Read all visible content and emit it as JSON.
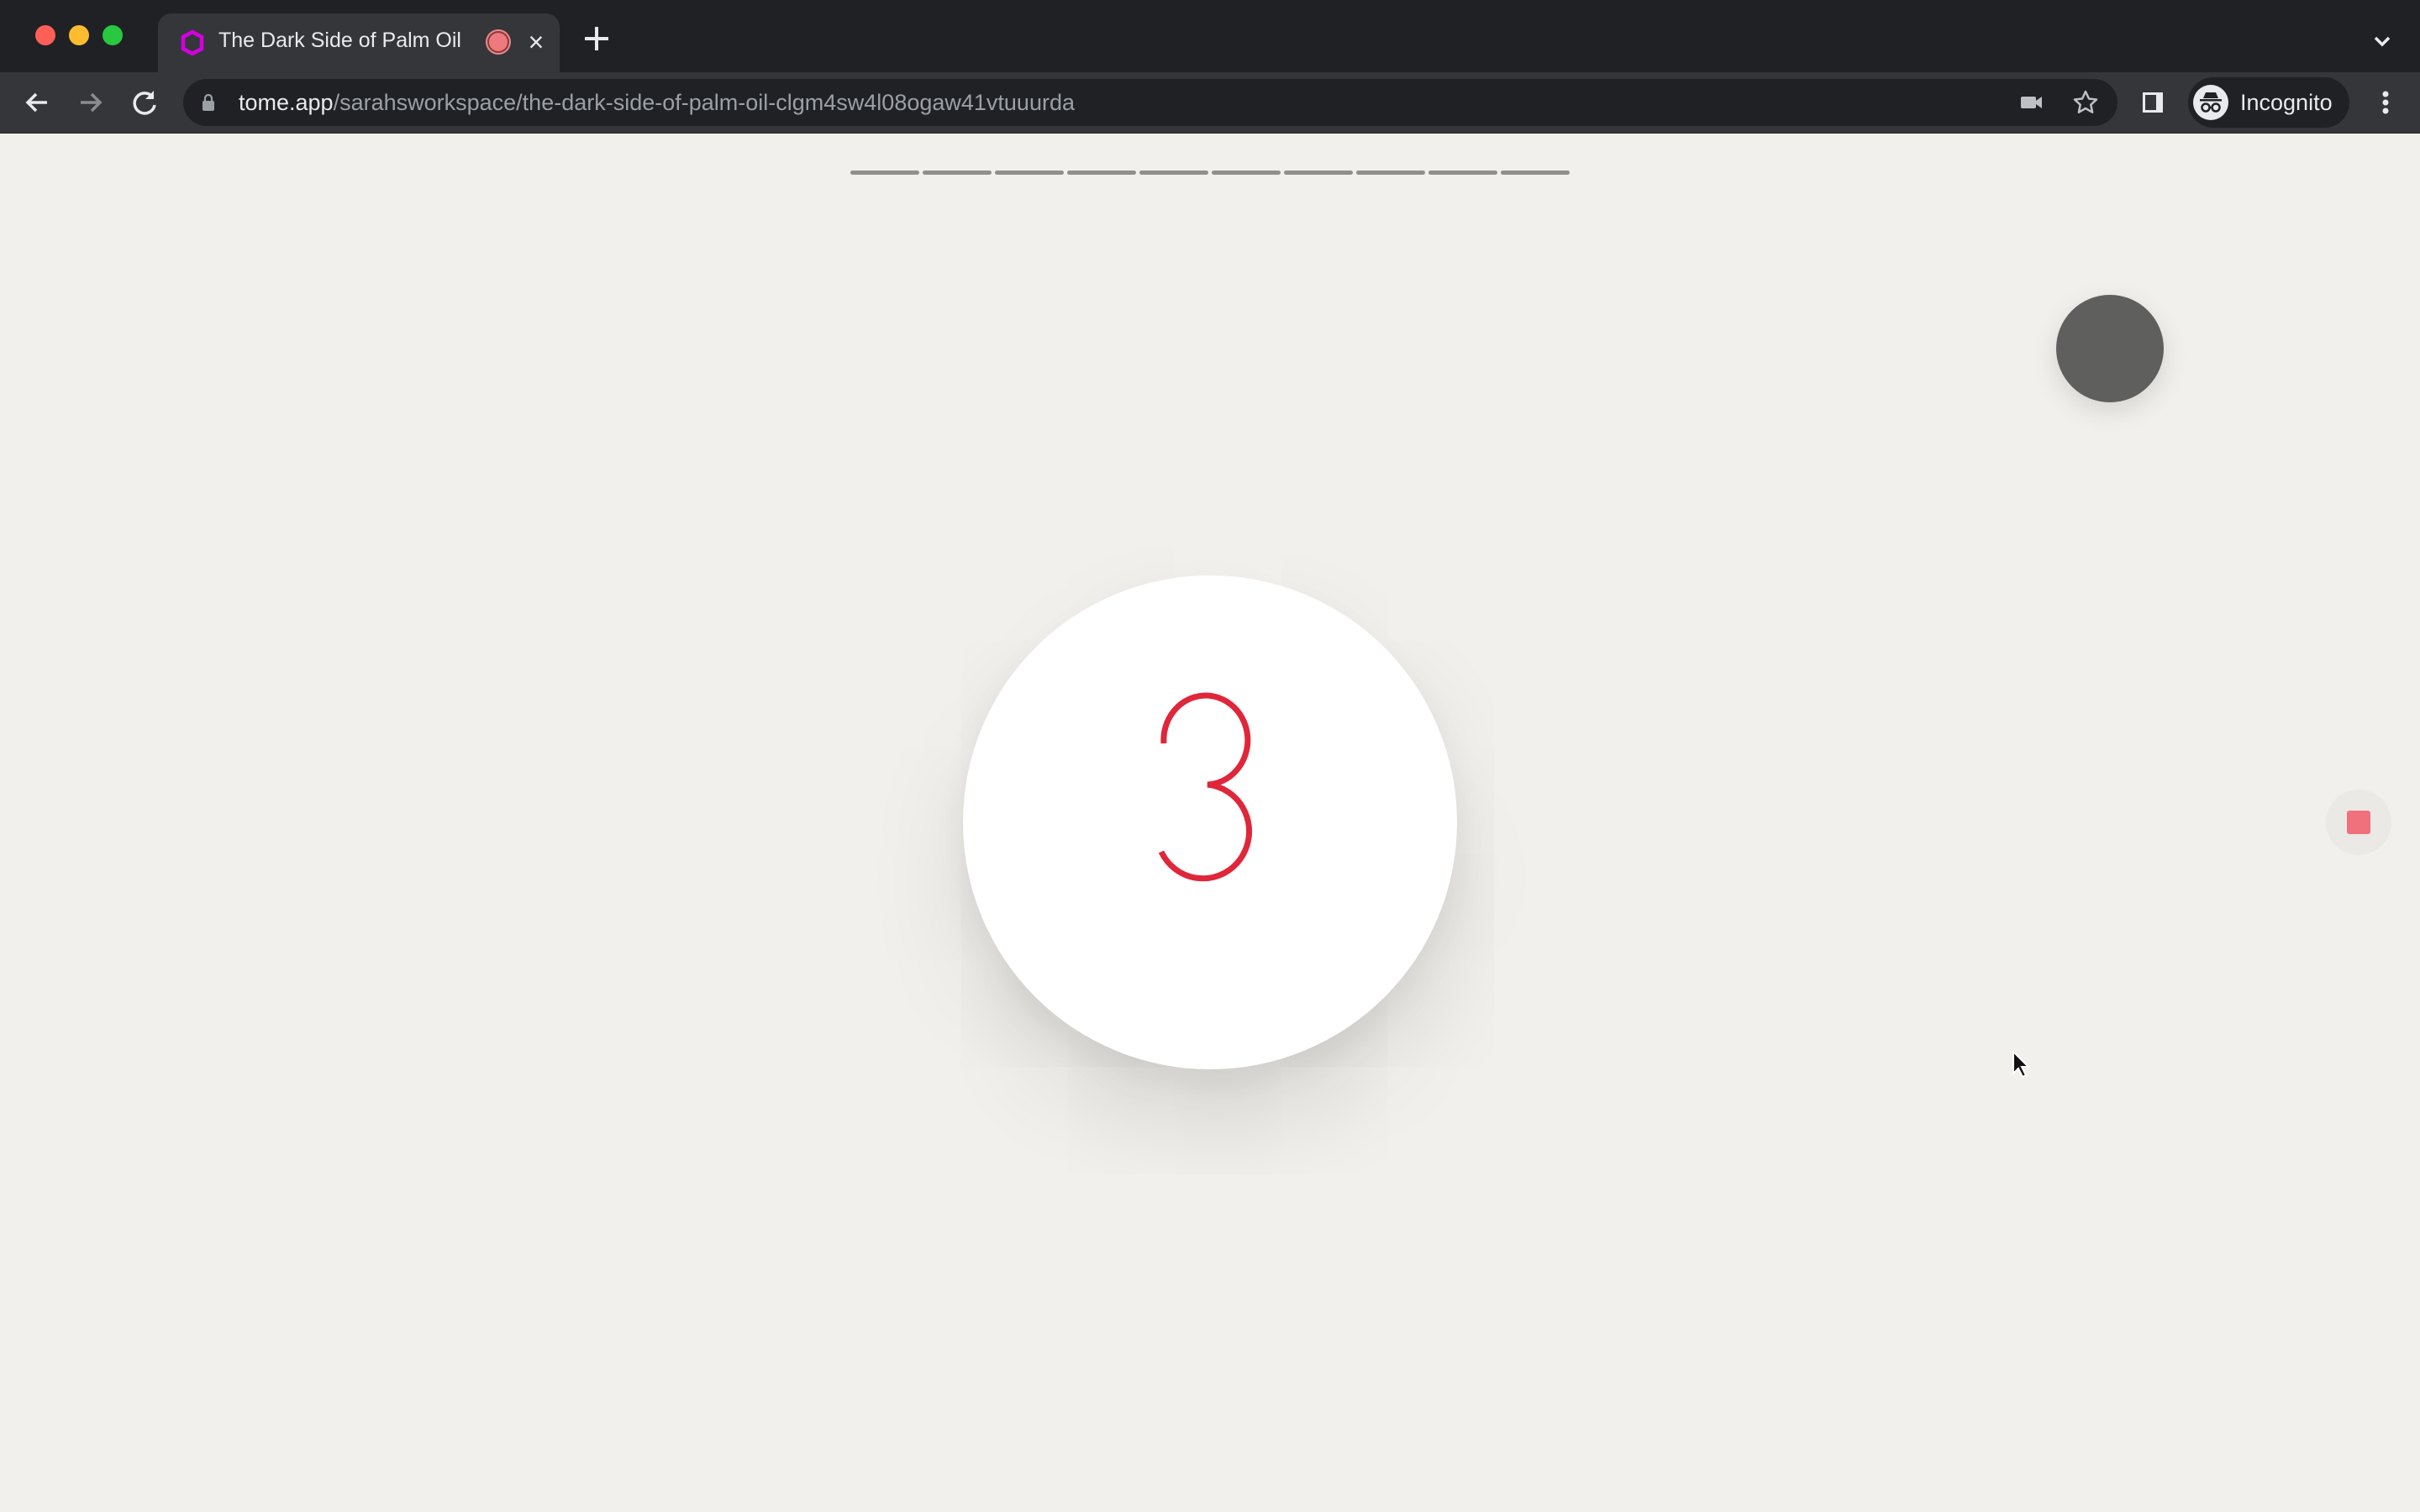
{
  "browser": {
    "tab": {
      "title": "The Dark Side of Palm Oil",
      "favicon": "tome-logo-icon",
      "recording_indicator": "recording-icon",
      "close_icon": "close-icon"
    },
    "new_tab_icon": "plus-icon",
    "tab_list_icon": "chevron-down-icon",
    "toolbar": {
      "back_icon": "arrow-left-icon",
      "forward_icon": "arrow-right-icon",
      "reload_icon": "reload-icon",
      "url_host": "tome.app",
      "url_path": "/sarahsworkspace/the-dark-side-of-palm-oil-clgm4sw4l08ogaw41vtuuurda",
      "camera_icon": "video-camera-icon",
      "bookmark_icon": "star-icon",
      "side_panel_icon": "side-panel-icon",
      "profile_label": "Incognito",
      "menu_icon": "kebab-menu-icon"
    }
  },
  "page": {
    "progress": {
      "total_segments": 10,
      "completed_segments": 0
    },
    "countdown": {
      "value": "3",
      "color": "#e0263a"
    },
    "presenter_bubble": {
      "color": "#5f5f5d"
    },
    "stop_recording": {
      "icon": "stop-icon",
      "color": "#f0707c"
    }
  },
  "colors": {
    "page_background": "#f2f0ec",
    "chrome_dark": "#202124",
    "chrome_toolbar": "#35363a"
  }
}
